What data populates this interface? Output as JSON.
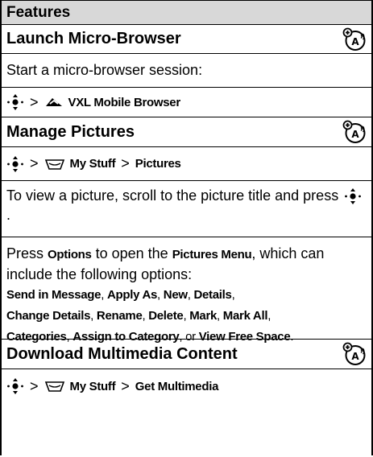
{
  "header": {
    "title": "Features"
  },
  "sections": {
    "launch": {
      "title": "Launch Micro-Browser",
      "description": "Start a micro-browser session:",
      "path": {
        "sep": ">",
        "item": "VXL Mobile Browser"
      }
    },
    "pictures": {
      "title": "Manage Pictures",
      "path": {
        "sep1": ">",
        "item1": "My Stuff",
        "sep2": ">",
        "item2": "Pictures"
      },
      "view_text": "To view a picture, scroll to the picture title and press",
      "view_end": ".",
      "press": "Press",
      "options_key": "Options",
      "to_open": "to open the",
      "menu_name": "Pictures Menu",
      "menu_suffix": ", which can include the following options:",
      "opt": {
        "send": "Send in Message",
        "c1": ", ",
        "apply": "Apply As",
        "c2": ", ",
        "new": "New",
        "c3": ", ",
        "details": "Details",
        "c4": ",",
        "change": "Change Details",
        "c5": ", ",
        "rename": "Rename",
        "c6": ", ",
        "delete": "Delete",
        "c7": ", ",
        "mark": "Mark",
        "c8": ", ",
        "markall": "Mark All",
        "c9": ",",
        "categories": "Categories",
        "c10": ", ",
        "assign": "Assign to Category",
        "c11": ", or ",
        "free": "View Free Space",
        "c12": "."
      }
    },
    "download": {
      "title": "Download Multimedia Content",
      "path": {
        "sep1": ">",
        "item1": "My Stuff",
        "sep2": ">",
        "item2": "Get Multimedia"
      }
    }
  },
  "icons": {
    "network": "network-feature-icon",
    "nav": "nav-key-icon",
    "browser": "browser-icon",
    "mystuff": "my-stuff-icon"
  }
}
